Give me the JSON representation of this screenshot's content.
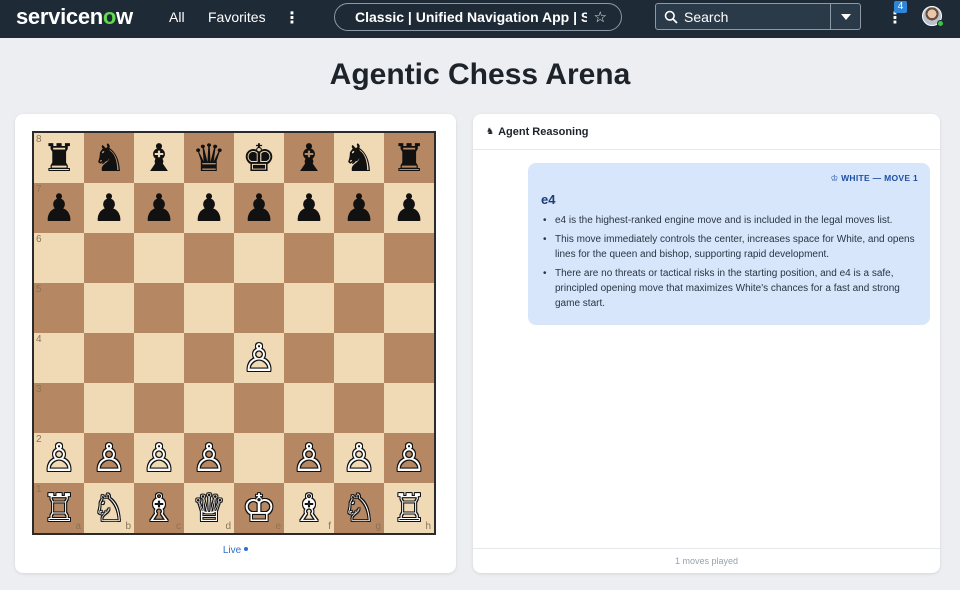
{
  "nav": {
    "logo_prefix": "servicen",
    "logo_o": "o",
    "logo_suffix": "w",
    "all": "All",
    "favorites": "Favorites",
    "more": "⋮",
    "app_pill": "Classic | Unified Navigation App | Se...",
    "star_icon": "☆",
    "search": "Search",
    "notifications_count": "4",
    "kebab": "⋮"
  },
  "page": {
    "title": "Agentic Chess Arena"
  },
  "board": {
    "rows": [
      [
        "♜",
        "♞",
        "♝",
        "♛",
        "♚",
        "♝",
        "♞",
        "♜"
      ],
      [
        "♟",
        "♟",
        "♟",
        "♟",
        "♟",
        "♟",
        "♟",
        "♟"
      ],
      [
        "",
        "",
        "",
        "",
        "",
        "",
        "",
        ""
      ],
      [
        "",
        "",
        "",
        "",
        "",
        "",
        "",
        ""
      ],
      [
        "",
        "",
        "",
        "",
        "♙",
        "",
        "",
        ""
      ],
      [
        "",
        "",
        "",
        "",
        "",
        "",
        "",
        ""
      ],
      [
        "♙",
        "♙",
        "♙",
        "♙",
        "",
        "♙",
        "♙",
        "♙"
      ],
      [
        "♖",
        "♘",
        "♗",
        "♕",
        "♔",
        "♗",
        "♘",
        "♖"
      ]
    ],
    "ranks": [
      "8",
      "7",
      "6",
      "5",
      "4",
      "3",
      "2",
      "1"
    ],
    "files": [
      "a",
      "b",
      "c",
      "d",
      "e",
      "f",
      "g",
      "h"
    ],
    "status": "Live"
  },
  "reasoning": {
    "header_icon": "♞",
    "header": "Agent Reasoning",
    "entry": {
      "meta": "♔ WHITE — MOVE 1",
      "move": "e4",
      "points": [
        "e4 is the highest-ranked engine move and is included in the legal moves list.",
        "This move immediately controls the center, increases space for White, and opens lines for the queen and bishop, supporting rapid development.",
        "There are no threats or tactical risks in the starting position, and e4 is a safe, principled opening move that maximizes White's chances for a fast and strong game start."
      ]
    },
    "footer": "1 moves played"
  }
}
